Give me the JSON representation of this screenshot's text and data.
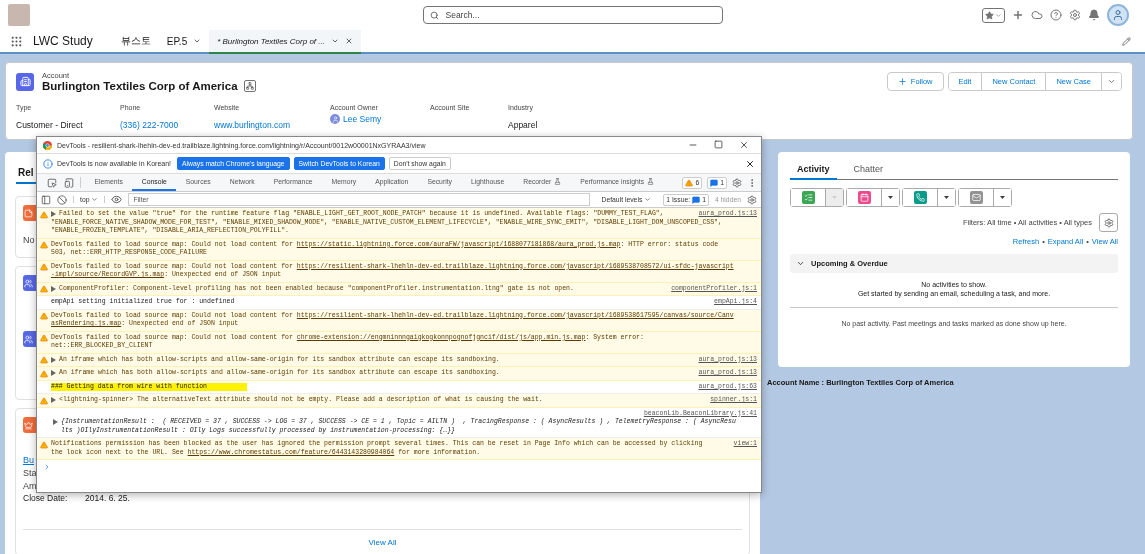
{
  "header": {
    "search": {
      "placeholder": "Search..."
    }
  },
  "nav": {
    "app_name": "LWC Study",
    "items": [
      {
        "label": "뷰스토",
        "kind": "item",
        "selected": false
      },
      {
        "label": "EP.5",
        "kind": "menu",
        "selected": false
      },
      {
        "label": "* Burlington Textiles Corp of ...",
        "kind": "tab",
        "selected": true
      }
    ]
  },
  "record": {
    "object": "Account",
    "name": "Burlington Textiles Corp of America",
    "follow": "Follow",
    "actions": [
      "Edit",
      "New Contact",
      "New Case"
    ],
    "fields": [
      {
        "label": "Type",
        "value": "Customer - Direct",
        "kind": "text"
      },
      {
        "label": "Phone",
        "value": "(336) 222-7000",
        "kind": "link"
      },
      {
        "label": "Website",
        "value": "www.burlington.com",
        "kind": "link"
      },
      {
        "label": "Account Owner",
        "value": "Lee Semy",
        "kind": "user"
      },
      {
        "label": "Account Site"
      },
      {
        "label": "Industry",
        "value": "Apparel",
        "kind": "text"
      }
    ]
  },
  "left_panel": {
    "tab": {
      "label": "Rel",
      "selected": true
    },
    "cards": [
      {
        "kind": "note",
        "text": "No"
      },
      {
        "kind": "contacts"
      },
      {
        "kind": "opportunity",
        "link": "Bu",
        "labels": [
          "Sta",
          "Am"
        ],
        "field": {
          "label": "Close Date:",
          "value": "2014. 6. 25."
        },
        "footer": "View All"
      }
    ]
  },
  "activity": {
    "tabs": [
      {
        "label": "Activity",
        "selected": true
      },
      {
        "label": "Chatter",
        "selected": false
      }
    ],
    "actions": [
      {
        "kind": "task",
        "disabled": true
      },
      {
        "kind": "event",
        "disabled": false
      },
      {
        "kind": "call",
        "disabled": false
      },
      {
        "kind": "email",
        "disabled": false
      }
    ],
    "filters": "Filters: All time • All activities • All types",
    "links": [
      "Refresh",
      "Expand All",
      "View All"
    ],
    "separator": "•",
    "section": {
      "title": "Upcoming & Overdue",
      "expanded": true,
      "empty_title": "No activities to show.",
      "empty_text": "Get started by sending an email, scheduling a task, and more."
    },
    "past": "No past activity. Past meetings and tasks marked as done show up here."
  },
  "account_line": "Account Name : Burlington Textiles Corp of America",
  "devtools": {
    "title": "DevTools - resilient-shark-lhehln-dev-ed.trailblaze.lightning.force.com/lightning/r/Account/0012w00001NxGYRAA3/view",
    "info_bar": {
      "message": "DevTools is now available in Korean!",
      "buttons": [
        {
          "label": "Always match Chrome's language",
          "kind": "primary"
        },
        {
          "label": "Switch DevTools to Korean",
          "kind": "primary"
        },
        {
          "label": "Don't show again",
          "kind": "secondary"
        }
      ]
    },
    "tabs": [
      {
        "label": "Elements",
        "selected": false,
        "experimental": false
      },
      {
        "label": "Console",
        "selected": true,
        "experimental": false
      },
      {
        "label": "Sources",
        "selected": false,
        "experimental": false
      },
      {
        "label": "Network",
        "selected": false,
        "experimental": false
      },
      {
        "label": "Performance",
        "selected": false,
        "experimental": false
      },
      {
        "label": "Memory",
        "selected": false,
        "experimental": false
      },
      {
        "label": "Application",
        "selected": false,
        "experimental": false
      },
      {
        "label": "Security",
        "selected": false,
        "experimental": false
      },
      {
        "label": "Lighthouse",
        "selected": false,
        "experimental": false
      },
      {
        "label": "Recorder",
        "selected": false,
        "experimental": true
      },
      {
        "label": "Performance insights",
        "selected": false,
        "experimental": true
      }
    ],
    "counters": {
      "warnings": "6",
      "messages": "1"
    },
    "console_bar": {
      "context": "top",
      "filter": {
        "placeholder": "Filter"
      },
      "levels": "Default levels",
      "issues": {
        "label": "1 Issue:",
        "count": "1"
      },
      "hidden": "4 hidden"
    },
    "messages": [
      {
        "kind": "warning",
        "expandable": true,
        "source": "aura_prod.js:13",
        "lines": [
          {
            "text": "Failed to set the value \"true\" for the runtime feature flag \"ENABLE_LIGHT_GET_ROOT_NODE_PATCH\" because it is undefined. Available flags: \"DUMMY_TEST_FLAG\","
          },
          {
            "text": "\"ENABLE_FORCE_NATIVE_SHADOW_MODE_FOR_TEST\", \"ENABLE_MIXED_SHADOW_MODE\", \"ENABLE_NATIVE_CUSTOM_ELEMENT_LIFECYCLE\", \"ENABLE_WIRE_SYNC_EMIT\", \"DISABLE_LIGHT_DOM_UNSCOPED_CSS\","
          },
          {
            "text": "\"ENABLE_FROZEN_TEMPLATE\", \"DISABLE_ARIA_REFLECTION_POLYFILL\"."
          }
        ]
      },
      {
        "kind": "warning",
        "expandable": false,
        "lines": [
          {
            "text": "DevTools failed to load source map: Could not load content for ",
            "link": "https://static.lightning.force.com/auraFW/javascript/1688077181868/aura_prod.js.map",
            "after": ": HTTP error: status code"
          },
          {
            "text": "503, net::ERR_HTTP_RESPONSE_CODE_FAILURE"
          }
        ]
      },
      {
        "kind": "warning",
        "expandable": false,
        "lines": [
          {
            "text": "DevTools failed to load source map: Could not load content for ",
            "link": "https://resilient-shark-lhehln-dev-ed.trailblaze.lightning.force.com/javascript/1689538708572/ui-sfdc-javascript"
          },
          {
            "link": "-impl/source/RecordGVP.js.map",
            "after": ": Unexpected end of JSON input"
          }
        ]
      },
      {
        "kind": "warning",
        "expandable": true,
        "source": "componentProfiler.js:1",
        "lines": [
          {
            "text": "ComponentProfiler: Component-level profiling has not been enabled because \"componentProfiler.instrumentation.ltng\" gate is not open."
          }
        ]
      },
      {
        "kind": "log",
        "expandable": false,
        "source": "empApi.js:4",
        "lines": [
          {
            "text": "empApi setting initialized true for : undefined"
          }
        ]
      },
      {
        "kind": "warning",
        "expandable": false,
        "lines": [
          {
            "text": "DevTools failed to load source map: Could not load content for ",
            "link": "https://resilient-shark-lhehln-dev-ed.trailblaze.lightning.force.com/javascript/1689538617595/canvas/source/Canv"
          },
          {
            "link": "asRendering.js.map",
            "after": ": Unexpected end of JSON input"
          }
        ]
      },
      {
        "kind": "warning",
        "expandable": false,
        "lines": [
          {
            "text": "DevTools failed to load source map: Could not load content for ",
            "link": "chrome-extension://engmninnngaigkogkonnpognofjgncif/dist/js/app.min.js.map",
            "after": ": System error:"
          },
          {
            "text": "net::ERR_BLOCKED_BY_CLIENT"
          }
        ]
      },
      {
        "kind": "warning",
        "expandable": true,
        "source": "aura_prod.js:13",
        "lines": [
          {
            "text": "An iframe which has both allow-scripts and allow-same-origin for its sandbox attribute can escape its sandboxing."
          }
        ]
      },
      {
        "kind": "warning",
        "expandable": true,
        "source": "aura_prod.js:13",
        "lines": [
          {
            "text": "An iframe which has both allow-scripts and allow-same-origin for its sandbox attribute can escape its sandboxing."
          }
        ]
      },
      {
        "kind": "highlight",
        "expandable": false,
        "source": "aura_prod.js:63",
        "lines": [
          {
            "text": "### Getting data from wire with function"
          }
        ]
      },
      {
        "kind": "warning",
        "expandable": true,
        "source": "spinner.js:1",
        "lines": [
          {
            "text": "<lightning-spinner> The alternativeText attribute should not be empty. Please add a description of what is causing the wait."
          }
        ]
      },
      {
        "kind": "object",
        "expandable": true,
        "source": "beaconLib.BeaconLibrary.js:41",
        "lines": [
          {
            "text": "{InstrumentationResult :  ( RECEIVED = 37 , SUCCESS -> LOG = 37 , SUCCESS -> CE = 1 , Topic = AILTN )  , TracingResponse : ( AsyncResults ) , TelemetryResponse : ( AsyncResu"
          },
          {
            "text": "lts )OIlyInstrumentationResult : OIly Logs successfully processed by instrumentation-processing: {…}}"
          }
        ]
      },
      {
        "kind": "warning",
        "expandable": false,
        "source": "view:1",
        "lines": [
          {
            "text": "Notifications permission has been blocked as the user has ignored the permission prompt several times. This can be reset in Page Info which can be accessed by clicking"
          },
          {
            "text": "the lock icon next to the URL. See ",
            "link": "https://www.chromestatus.com/feature/6443143280984064",
            "after": " for more information."
          }
        ]
      }
    ]
  }
}
